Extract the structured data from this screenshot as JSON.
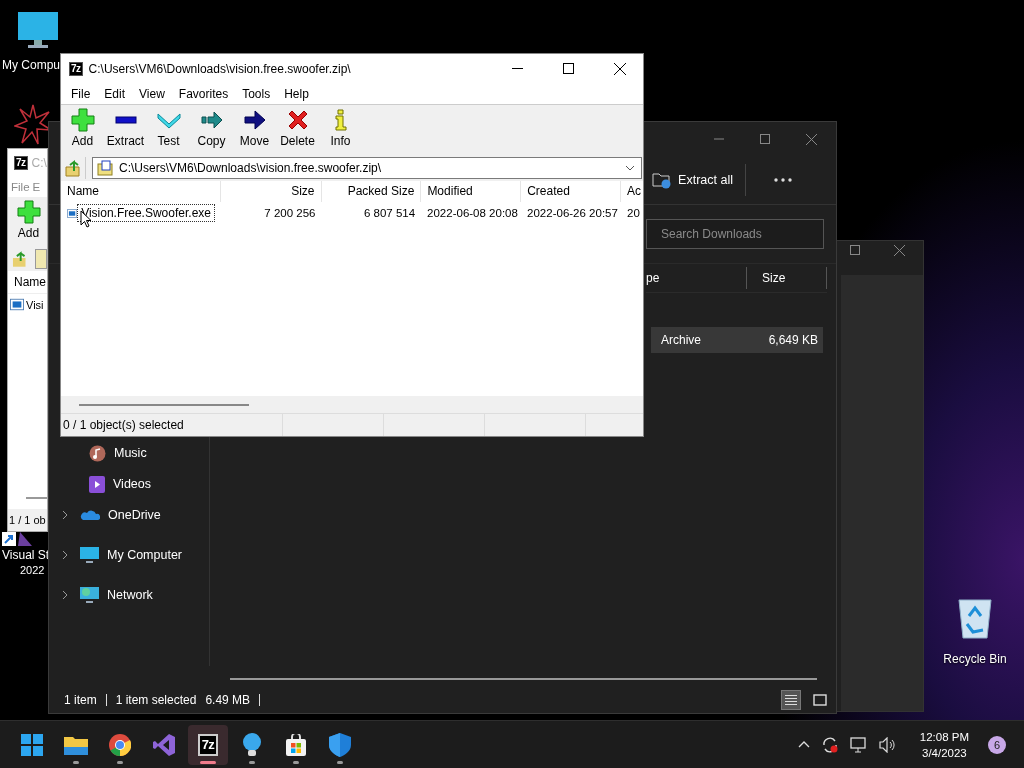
{
  "desktop": {
    "icons": [
      {
        "kind": "computer",
        "lines": [
          "My Compu"
        ]
      },
      {
        "kind": "visualstudio",
        "lines": [
          "Visual St",
          "2022"
        ]
      },
      {
        "kind": "recycle",
        "lines": [
          "Recycle Bin"
        ]
      }
    ]
  },
  "explorer": {
    "toolbar": {
      "extract_label": "Extract all"
    },
    "search": {
      "placeholder": "Search Downloads"
    },
    "columns": [
      "pe",
      "Size"
    ],
    "rows": [
      {
        "type": "Archive",
        "size": "6,649 KB",
        "selected": true
      }
    ],
    "sidebar": [
      {
        "label": "Music",
        "kind": "music"
      },
      {
        "label": "Videos",
        "kind": "videos"
      },
      {
        "label": "OneDrive",
        "kind": "onedrive",
        "expanded": false
      },
      {
        "label": "My Computer",
        "kind": "computer",
        "expanded": false
      },
      {
        "label": "Network",
        "kind": "network",
        "expanded": false
      }
    ],
    "status": {
      "count": "1 item",
      "selection": "1 item selected",
      "size": "6.49 MB"
    },
    "views": [
      {
        "kind": "details",
        "selected": true
      },
      {
        "kind": "tiles",
        "selected": false
      }
    ]
  },
  "back_7z": {
    "app_icon_text": "7z",
    "title": "C:\\",
    "menu": [
      "File",
      "E"
    ],
    "toolbar": [
      {
        "kind": "add",
        "label": "Add"
      }
    ],
    "column": "Name",
    "row": "Visi",
    "status": "1 / 1 ob"
  },
  "front_7z": {
    "app_icon_text": "7z",
    "title": "C:\\Users\\VM6\\Downloads\\vision.free.swoofer.zip\\",
    "menu": [
      "File",
      "Edit",
      "View",
      "Favorites",
      "Tools",
      "Help"
    ],
    "toolbar": [
      {
        "kind": "add",
        "label": "Add"
      },
      {
        "kind": "extract",
        "label": "Extract"
      },
      {
        "kind": "test",
        "label": "Test"
      },
      {
        "kind": "copy",
        "label": "Copy"
      },
      {
        "kind": "move",
        "label": "Move"
      },
      {
        "kind": "delete",
        "label": "Delete"
      },
      {
        "kind": "info",
        "label": "Info"
      }
    ],
    "address": "C:\\Users\\VM6\\Downloads\\vision.free.swoofer.zip\\",
    "columns": [
      "Name",
      "Size",
      "Packed Size",
      "Modified",
      "Created",
      "Ac"
    ],
    "rows": [
      {
        "cells": [
          "Vision.Free.Swoofer.exe",
          "7 200 256",
          "6 807 514",
          "2022-06-08 20:08",
          "2022-06-26 20:57",
          "20"
        ],
        "focused": true
      }
    ],
    "status": "0 / 1 object(s) selected"
  },
  "taskbar": {
    "apps": [
      {
        "kind": "start",
        "running": false,
        "active": false
      },
      {
        "kind": "explorer",
        "running": true,
        "active": false
      },
      {
        "kind": "chrome",
        "running": true,
        "active": false
      },
      {
        "kind": "vs",
        "running": false,
        "active": false
      },
      {
        "kind": "sevenzip",
        "label": "7z",
        "running": true,
        "active": true
      },
      {
        "kind": "bulb",
        "running": true,
        "active": false
      },
      {
        "kind": "store",
        "running": true,
        "active": false
      },
      {
        "kind": "shield",
        "running": true,
        "active": false
      }
    ],
    "time": "12:08 PM",
    "date": "3/4/2023",
    "notifications": "6"
  }
}
